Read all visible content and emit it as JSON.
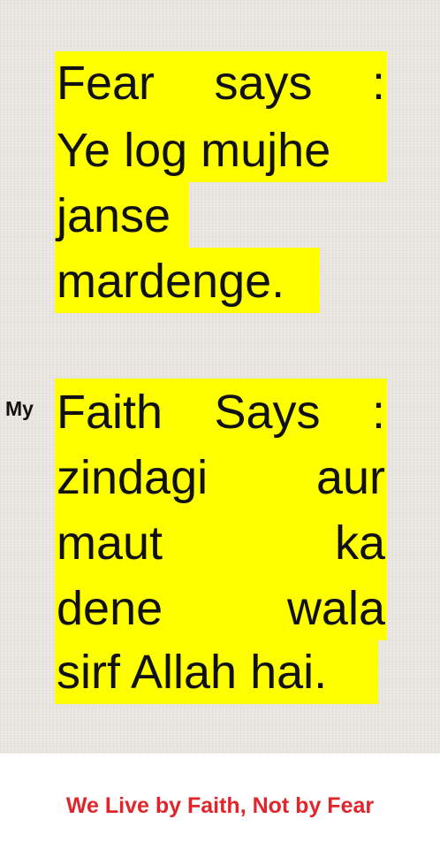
{
  "fear": {
    "lines": [
      "Fear says :",
      "Ye log mujhe",
      "janse",
      "mardenge."
    ],
    "line1": [
      "Fear",
      "says",
      ":"
    ]
  },
  "faith": {
    "prefix": "My",
    "lines": [
      "Faith Says :",
      "zindagi aur",
      "maut ka",
      "dene wala",
      "sirf Allah hai."
    ],
    "line1": [
      "Faith",
      "Says",
      ":"
    ],
    "line2": [
      "zindagi",
      "aur"
    ],
    "line3": [
      "maut",
      "ka"
    ],
    "line4": [
      "dene",
      "wala"
    ]
  },
  "caption": "We Live by Faith, Not by Fear",
  "colors": {
    "highlight": "#ffff00",
    "caption": "#e0262b",
    "background": "#e9e6e1"
  }
}
